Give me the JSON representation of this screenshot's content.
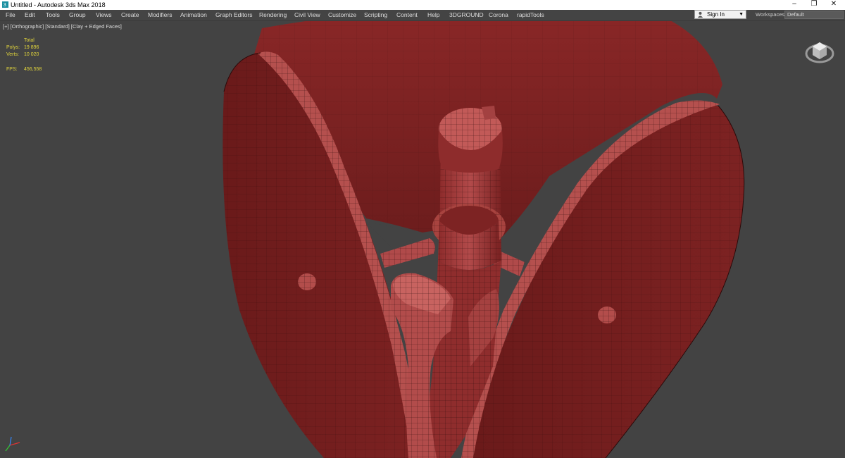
{
  "window": {
    "title": "Untitled - Autodesk 3ds Max 2018",
    "controls": {
      "minimize": "–",
      "restore": "❐",
      "close": "✕"
    }
  },
  "menu": {
    "items": [
      "File",
      "Edit",
      "Tools",
      "Group",
      "Views",
      "Create",
      "Modifiers",
      "Animation",
      "Graph Editors",
      "Rendering",
      "Civil View",
      "Customize",
      "Scripting",
      "Content",
      "Help",
      "3DGROUND",
      "Corona",
      "rapidTools"
    ]
  },
  "account": {
    "sign_in": "Sign In"
  },
  "workspace": {
    "label": "Workspaces:",
    "value": "Default"
  },
  "viewport": {
    "label": "[+] [Orthographic] [Standard] [Clay + Edged Faces]",
    "stats": {
      "header": "Total",
      "polys_label": "Polys:",
      "polys_value": "19 896",
      "verts_label": "Verts:",
      "verts_value": "10 020",
      "fps_label": "FPS:",
      "fps_value": "456,558"
    }
  },
  "icons": {
    "app": "3dsmax-icon",
    "viewcube": "viewcube-icon",
    "axis": "axis-tripod-icon",
    "user": "user-icon"
  },
  "colors": {
    "model": "#7a1f1f",
    "model_light": "#b04a4a",
    "wire": "#2b0a0a",
    "stats_text": "#e3d63c",
    "viewport_bg": "#434343"
  }
}
